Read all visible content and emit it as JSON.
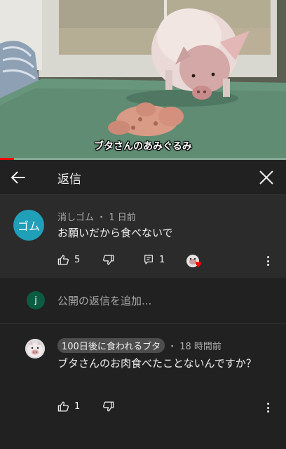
{
  "video": {
    "caption": "ブタさんのあみぐるみ",
    "progress": 0.05,
    "progress_color": "#ff0000"
  },
  "header": {
    "back_icon": "arrow-left-icon",
    "title": "返信",
    "close_icon": "close-icon"
  },
  "comment": {
    "avatar_text": "ゴム",
    "avatar_color": "#1f9fb8",
    "author": "消しゴム",
    "time": "1 日前",
    "text": "お願いだから食べないで",
    "likes": "5",
    "replies": "1",
    "icons": [
      "thumb-up-icon",
      "thumb-down-icon",
      "reply-icon",
      "creator-heart-icon",
      "more-vert-icon"
    ]
  },
  "add_reply": {
    "avatar_letter": "j",
    "avatar_color": "#0b5c42",
    "placeholder": "公開の返信を追加..."
  },
  "reply": {
    "author": "100日後に食われるブタ",
    "time": "18 時間前",
    "text": "ブタさんのお肉食べたことないんですか？",
    "likes": "1",
    "icons": [
      "thumb-up-icon",
      "thumb-down-icon",
      "more-vert-icon"
    ]
  }
}
